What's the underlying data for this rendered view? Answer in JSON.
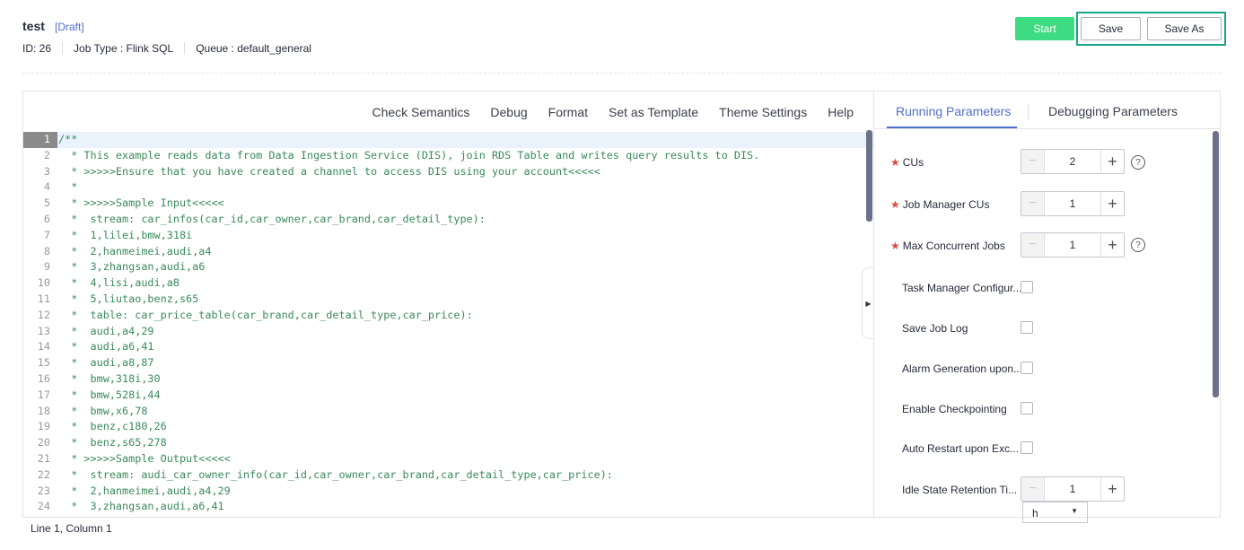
{
  "header": {
    "title": "test",
    "status": "[Draft]",
    "id": "ID:  26",
    "job_type": "Job Type :  Flink SQL",
    "queue": "Queue :  default_general"
  },
  "actions": {
    "start": "Start",
    "save": "Save",
    "save_as": "Save As"
  },
  "toolbar": [
    "Check Semantics",
    "Debug",
    "Format",
    "Set as Template",
    "Theme Settings",
    "Help"
  ],
  "code_lines": [
    "/**",
    "  * This example reads data from Data Ingestion Service (DIS), join RDS Table and writes query results to DIS.",
    "  * >>>>>Ensure that you have created a channel to access DIS using your account<<<<<",
    "  *",
    "  * >>>>>Sample Input<<<<<",
    "  *  stream: car_infos(car_id,car_owner,car_brand,car_detail_type):",
    "  *  1,lilei,bmw,318i",
    "  *  2,hanmeimei,audi,a4",
    "  *  3,zhangsan,audi,a6",
    "  *  4,lisi,audi,a8",
    "  *  5,liutao,benz,s65",
    "  *  table: car_price_table(car_brand,car_detail_type,car_price):",
    "  *  audi,a4,29",
    "  *  audi,a6,41",
    "  *  audi,a8,87",
    "  *  bmw,318i,30",
    "  *  bmw,528i,44",
    "  *  bmw,x6,78",
    "  *  benz,c180,26",
    "  *  benz,s65,278",
    "  * >>>>>Sample Output<<<<<",
    "  *  stream: audi_car_owner_info(car_id,car_owner,car_brand,car_detail_type,car_price):",
    "  *  2,hanmeimei,audi,a4,29",
    "  *  3,zhangsan,audi,a6,41"
  ],
  "panel": {
    "tabs": [
      "Running Parameters",
      "Debugging Parameters"
    ],
    "cus": {
      "label": "CUs",
      "value": "2"
    },
    "jm_cus": {
      "label": "Job Manager CUs",
      "value": "1"
    },
    "max_jobs": {
      "label": "Max Concurrent Jobs",
      "value": "1"
    },
    "checkboxes": [
      "Task Manager Configur...",
      "Save Job Log",
      "Alarm Generation upon...",
      "Enable Checkpointing",
      "Auto Restart upon Exc..."
    ],
    "idle": {
      "label": "Idle State Retention Ti...",
      "value": "1",
      "unit": "h"
    }
  },
  "status_bar": "Line 1, Column 1",
  "colors": {
    "accent": "#526ecc",
    "start": "#3ddc84",
    "highlight": "#1aa68a",
    "code": "#3a8a5c"
  }
}
